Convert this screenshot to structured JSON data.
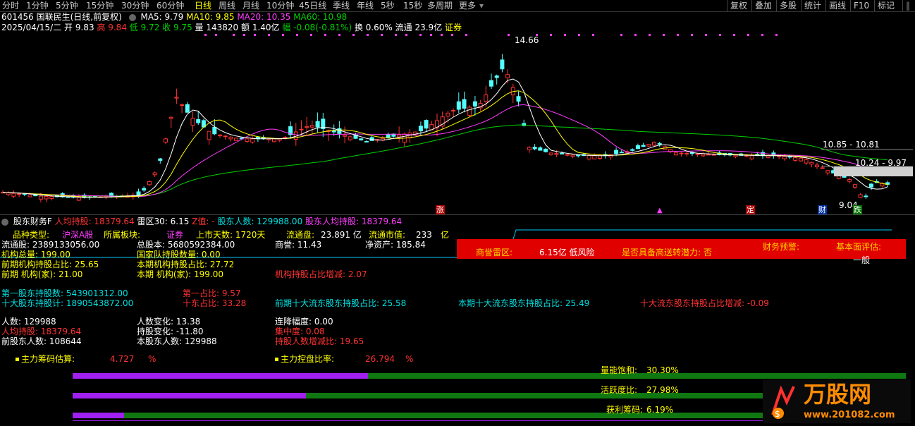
{
  "tabs": [
    "分时",
    "1分钟",
    "5分钟",
    "15分钟",
    "30分钟",
    "60分钟",
    "日线",
    "周线",
    "月线",
    "10分钟",
    "45日线",
    "季线",
    "年线",
    "5秒",
    "15秒",
    "多周期",
    "更多"
  ],
  "active_tab": "日线",
  "right_buttons": [
    "复权",
    "叠加",
    "多股",
    "统计",
    "画线",
    "F10",
    "标记"
  ],
  "stock_line": {
    "code_name": "601456 国联民生(日线,前复权)",
    "ma5": "MA5: 9.79",
    "ma10": "MA10: 9.85",
    "ma20": "MA20: 10.35",
    "ma60": "MA60: 10.98"
  },
  "info_line": {
    "date": "2025/04/15/二",
    "open": "开 9.83",
    "high": "高 9.84",
    "low": "低 9.72",
    "close": "收 9.75",
    "vol": "量 143820",
    "amount": "额 1.40亿",
    "change": "幅 -0.08(-0.81%)",
    "turnover": "换 0.60%",
    "float": "流通 23.9亿",
    "sec": "证券"
  },
  "chart_labels": {
    "high_price": "14.66",
    "low_price": "9.04",
    "range1": "10.85 - 10.81",
    "range2": "10.24 - 9.97",
    "zhang": "涨",
    "ding": "定",
    "cai": "财",
    "die": "跌"
  },
  "sub_header": {
    "title": "股东财务F",
    "avg_hold": "人均持股: 18379.64",
    "leiqu": "雷区30: 6.15",
    "z": "Z值: -",
    "holders": "股东人数: 129988.00",
    "holders_avg": "股东人均持股: 18379.64"
  },
  "f": {
    "l1a": "品种类型:",
    "l1b": "沪深A股",
    "l1c": "所属板块:",
    "l1d": "证券",
    "l1e": "上市天数: 1720天",
    "l1f": "流通盘:",
    "l1g": "23.891 亿",
    "l1h": "流通市值:",
    "l1i": "233",
    "l1j": "亿",
    "l2a": "流通股: 2389133056.00",
    "l2b": "总股本: 5680592384.00",
    "l2c": "商誉: 11.43",
    "l2d": "净资产: 185.84",
    "l3a": "机构总量: 199.00",
    "l3b": "国家队持股数量: 0.00",
    "l4a": "前期机构持股占比: 25.65",
    "l4b": "本期机构持股占比: 27.72",
    "l5a": "前期 机构(家): 21.00",
    "l5b": "本期 机构(家): 199.00",
    "l5c": "机构持股占比增减: 2.07",
    "l6a": "第一股东持股数: 543901312.00",
    "l6b": "第一占比: 9.57",
    "l7a": "十大股东持股计: 1890543872.00",
    "l7b": "十东占比: 33.28",
    "l7c": "前期十大流东股东持股占比: 25.58",
    "l7d": "本期十大流东股东持股占比: 25.49",
    "l7e": "十大流东股东持股占比增减: -0.09",
    "l8a": "人数: 129988",
    "l8b": "人数变化: 13.38",
    "l8c": "连降幅度: 0.00",
    "l9a": "人均持股: 18379.64",
    "l9b": "持股变化: -11.80",
    "l9c": "集中度: 0.08",
    "l10a": "前股东人数: 108644",
    "l10b": "本股东人数: 129988",
    "l10c": "持股人数增减比: 19.65",
    "l11a": "主力筹码估算:",
    "l11b": "4.727",
    "l11c": "%",
    "l11d": "主力控盘比率:",
    "l11e": "26.794",
    "l11f": "%"
  },
  "warning_bar": {
    "a": "商誉雷区:",
    "b": "6.15亿 低风险",
    "c": "是否具备高送转潜力: 否",
    "d": "财务预警:",
    "e": "基本面评估:",
    "f": "一般"
  },
  "progress": {
    "liangneng_label": "量能饱和:",
    "liangneng_value": "30.30%",
    "liangneng": 0.303,
    "huoyue_label": "活跃度比:",
    "huoyue_value": "27.98%",
    "huoyue": 0.2798,
    "huoli_label": "获利筹码:",
    "huoli_value": "6.19%",
    "huoli": 0.0619
  },
  "watermark": {
    "brand": "万股网",
    "site": "www.201082.com"
  },
  "colors": {
    "up": "#ff3232",
    "down": "#54ffff",
    "ma5": "#ffffff",
    "ma10": "#ffff00",
    "ma20": "#ff3cff",
    "ma60": "#00d000",
    "bar_purple": "#b020ff",
    "bar_green": "#107810"
  },
  "icons": [
    "collapse-circle-icon",
    "square-bullet-icon",
    "logo-icon"
  ]
}
